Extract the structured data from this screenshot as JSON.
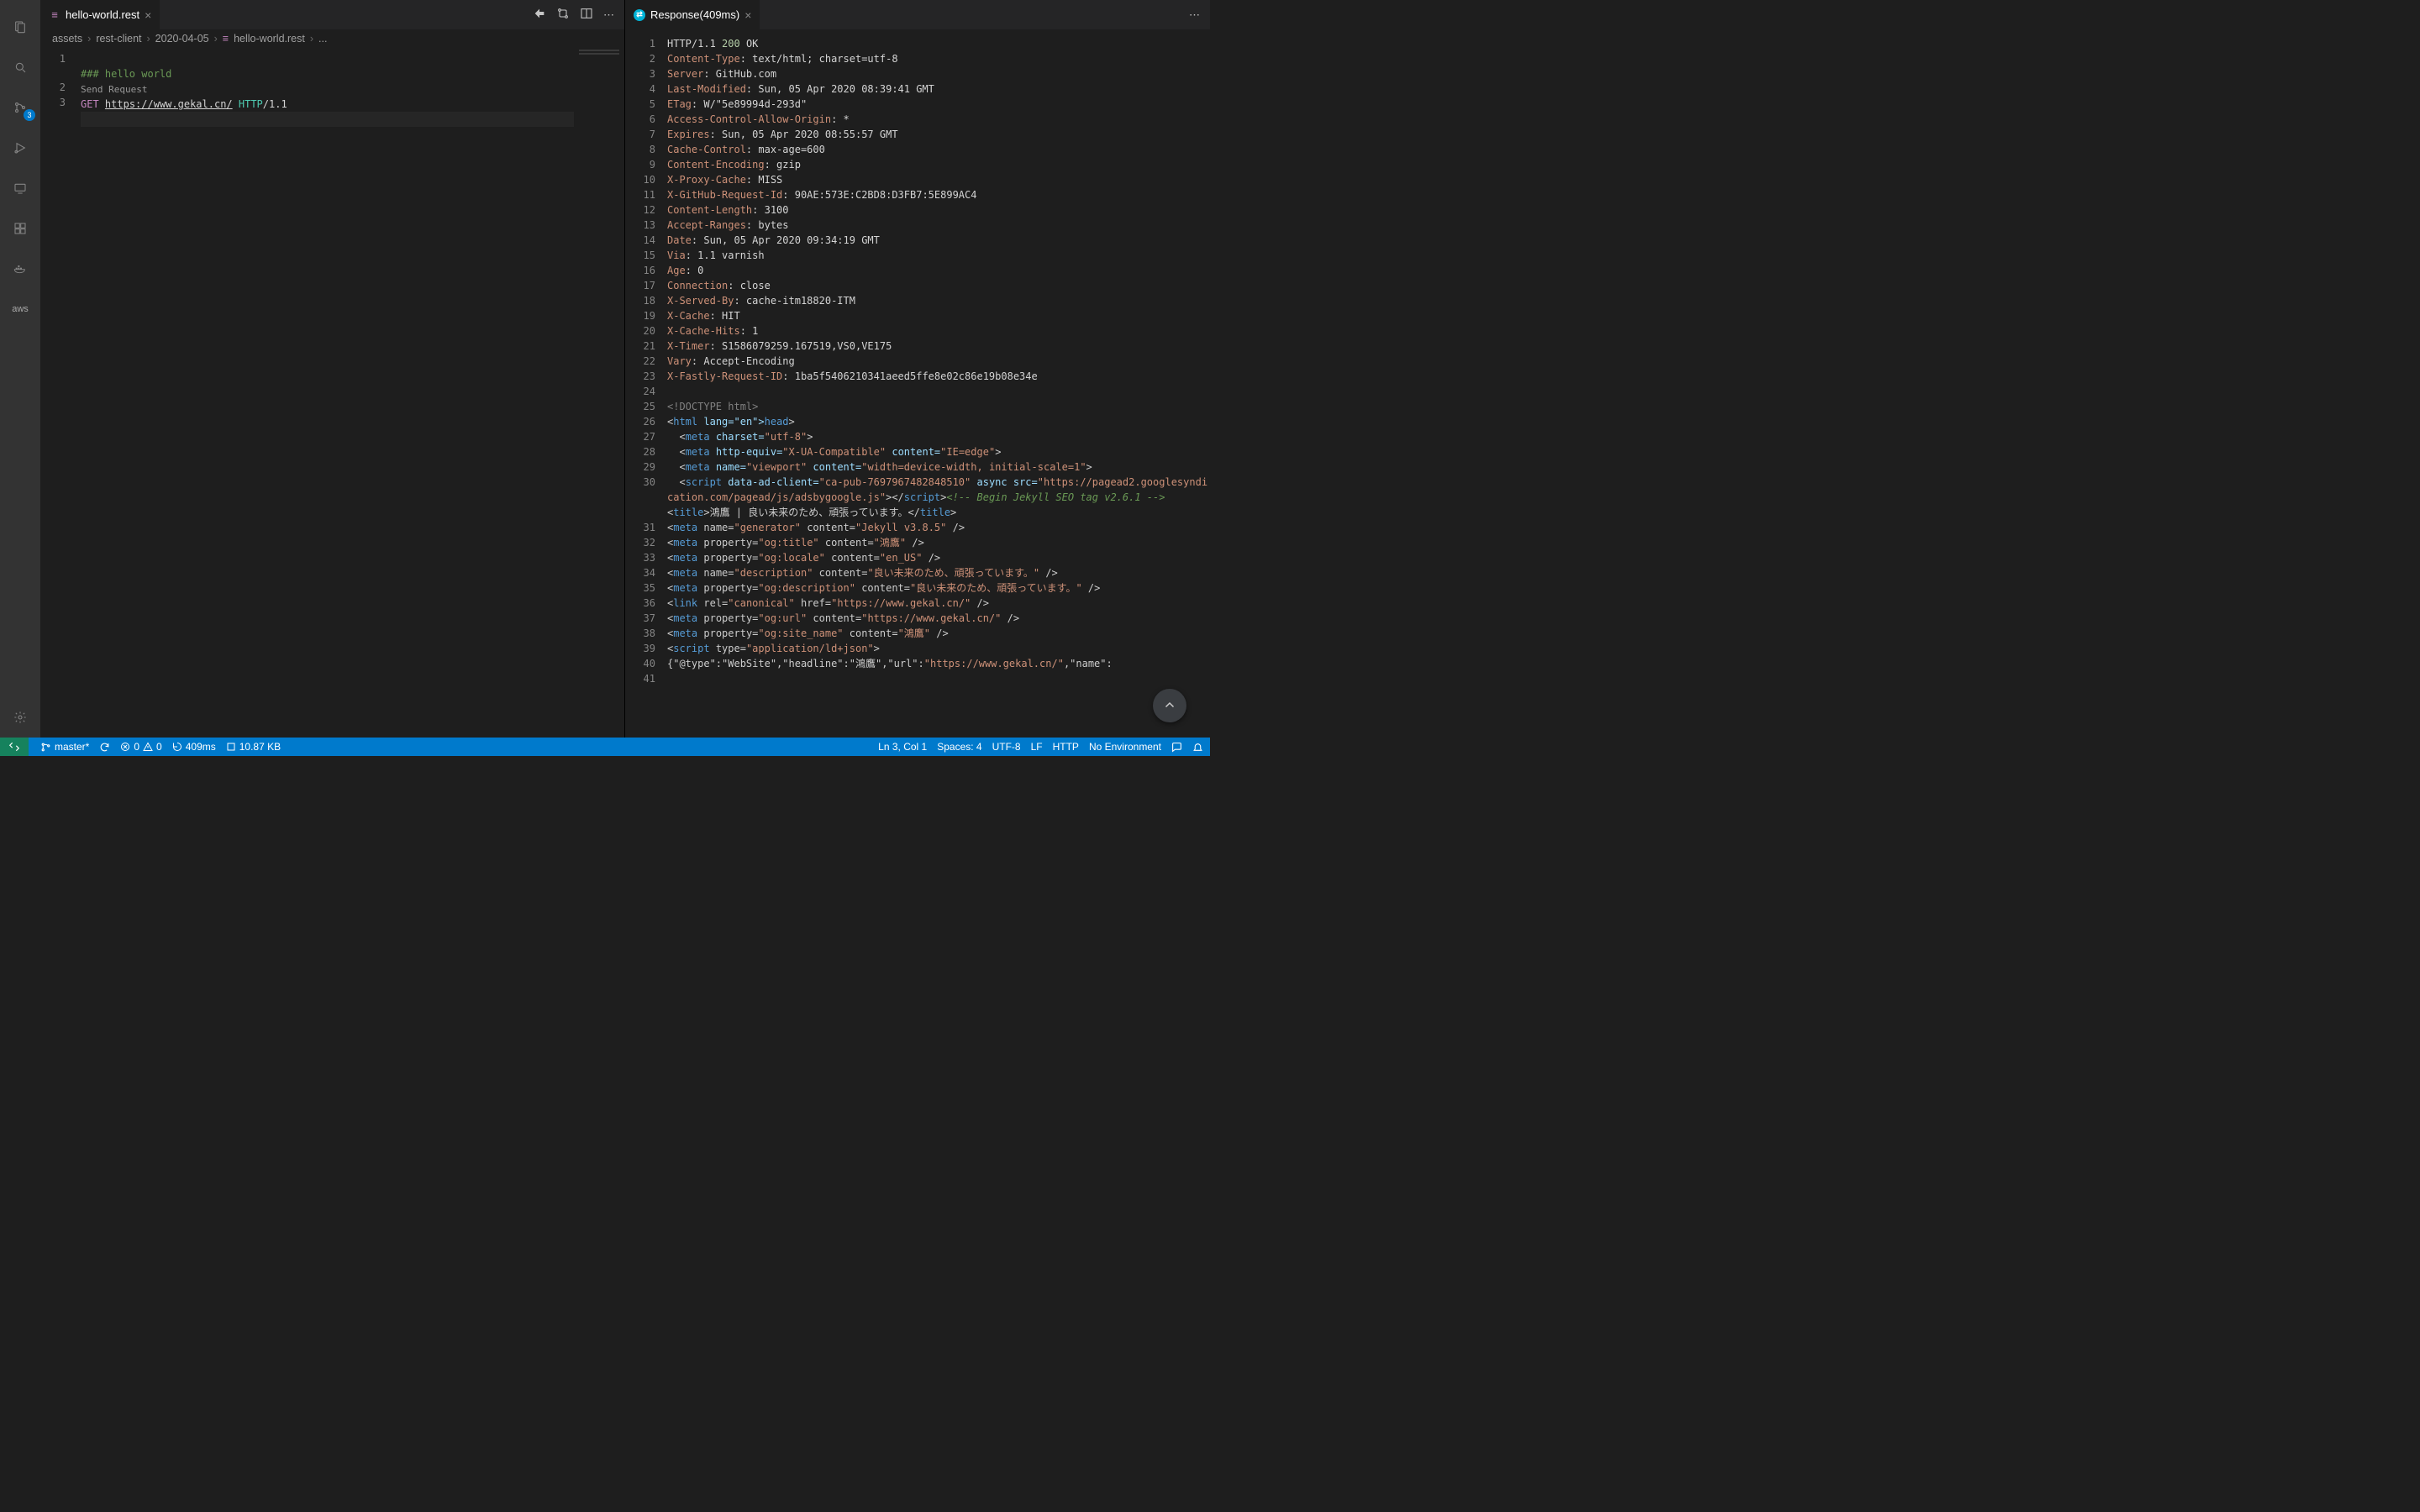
{
  "activityBadge": "3",
  "leftTab": {
    "name": "hello-world.rest"
  },
  "breadcrumbs": [
    "assets",
    "rest-client",
    "2020-04-05",
    "hello-world.rest",
    "..."
  ],
  "editor": {
    "lines": [
      "1",
      "2",
      "3"
    ],
    "commentLine": "### hello world",
    "codelens": "Send Request",
    "method": "GET",
    "url": "https://www.gekal.cn/",
    "proto": "HTTP",
    "protoVer": "/1.1"
  },
  "rightTab": {
    "name": "Response(409ms)"
  },
  "response": {
    "statusLine": {
      "proto": "HTTP/1.1",
      "code": "200",
      "text": "OK"
    },
    "headers": [
      {
        "k": "Content-Type",
        "v": ": text/html; charset=utf-8"
      },
      {
        "k": "Server",
        "v": ": GitHub.com"
      },
      {
        "k": "Last-Modified",
        "v": ": Sun, 05 Apr 2020 08:39:41 GMT"
      },
      {
        "k": "ETag",
        "v": ": W/\"5e89994d-293d\""
      },
      {
        "k": "Access-Control-Allow-Origin",
        "v": ": *"
      },
      {
        "k": "Expires",
        "v": ": Sun, 05 Apr 2020 08:55:57 GMT"
      },
      {
        "k": "Cache-Control",
        "v": ": max-age=600"
      },
      {
        "k": "Content-Encoding",
        "v": ": gzip"
      },
      {
        "k": "X-Proxy-Cache",
        "v": ": MISS"
      },
      {
        "k": "X-GitHub-Request-Id",
        "v": ": 90AE:573E:C2BD8:D3FB7:5E899AC4"
      },
      {
        "k": "Content-Length",
        "v": ": 3100"
      },
      {
        "k": "Accept-Ranges",
        "v": ": bytes"
      },
      {
        "k": "Date",
        "v": ": Sun, 05 Apr 2020 09:34:19 GMT"
      },
      {
        "k": "Via",
        "v": ": 1.1 varnish"
      },
      {
        "k": "Age",
        "v": ": 0"
      },
      {
        "k": "Connection",
        "v": ": close"
      },
      {
        "k": "X-Served-By",
        "v": ": cache-itm18820-ITM"
      },
      {
        "k": "X-Cache",
        "v": ": HIT"
      },
      {
        "k": "X-Cache-Hits",
        "v": ": 1"
      },
      {
        "k": "X-Timer",
        "v": ": S1586079259.167519,VS0,VE175"
      },
      {
        "k": "Vary",
        "v": ": Accept-Encoding"
      },
      {
        "k": "X-Fastly-Request-ID",
        "v": ": 1ba5f5406210341aeed5ffe8e02c86e19b08e34e"
      }
    ],
    "body": {
      "doctype": "<!DOCTYPE html>",
      "htmlOpen": {
        "pre": "<",
        "tag": "html",
        "rest": " lang=\"en\"><",
        "tag2": "head",
        "post": ">"
      },
      "metas": [
        {
          "indent": "  ",
          "pre": "<",
          "tag": "meta",
          "attrs": " charset=",
          "str": "\"utf-8\"",
          "post": ">"
        },
        {
          "indent": "  ",
          "pre": "<",
          "tag": "meta",
          "attrs": " http-equiv=",
          "str": "\"X-UA-Compatible\"",
          "attrs2": " content=",
          "str2": "\"IE=edge\"",
          "post": ">"
        },
        {
          "indent": "  ",
          "pre": "<",
          "tag": "meta",
          "attrs": " name=",
          "str": "\"viewport\"",
          "attrs2": " content=",
          "str2": "\"width=device-width, initial-scale=1\"",
          "post": ">"
        }
      ],
      "scriptLine": {
        "indent": "  ",
        "tag": "script",
        "attrs": " data-ad-client=",
        "str": "\"ca-pub-7697967482848510\"",
        "attrs2": " async src=",
        "str2": "\"https://pagead2.googlesyndication.com/pagead/js/adsbygoogle.js\"",
        "closeTag": "script",
        "commentTail": "<!-- Begin Jekyll SEO tag v2.6.1 -->"
      },
      "afterLines": [
        {
          "n": "31",
          "html": "<<t>title</t>>鴻鷹 | 良い未来のため、頑張っています。</<t>title</t>>"
        },
        {
          "n": "32",
          "html": "<<t>meta</t> name=<s>\"generator\"</s> content=<s>\"Jekyll v3.8.5\"</s> />"
        },
        {
          "n": "33",
          "html": "<<t>meta</t> property=<s>\"og:title\"</s> content=<s>\"鴻鷹\"</s> />"
        },
        {
          "n": "34",
          "html": "<<t>meta</t> property=<s>\"og:locale\"</s> content=<s>\"en_US\"</s> />"
        },
        {
          "n": "35",
          "html": "<<t>meta</t> name=<s>\"description\"</s> content=<s>\"良い未来のため、頑張っています。\"</s> />"
        },
        {
          "n": "36",
          "html": "<<t>meta</t> property=<s>\"og:description\"</s> content=<s>\"良い未来のため、頑張っています。\"</s> />"
        },
        {
          "n": "37",
          "html": "<<t>link</t> rel=<s>\"canonical\"</s> href=<s>\"https://www.gekal.cn/\"</s> />"
        },
        {
          "n": "38",
          "html": "<<t>meta</t> property=<s>\"og:url\"</s> content=<s>\"https://www.gekal.cn/\"</s> />"
        },
        {
          "n": "39",
          "html": "<<t>meta</t> property=<s>\"og:site_name\"</s> content=<s>\"鴻鷹\"</s> />"
        },
        {
          "n": "40",
          "html": "<<t>script</t> type=<s>\"application/ld+json\"</s>>"
        },
        {
          "n": "41",
          "html": "{\"@type\":\"WebSite\",\"headline\":\"鴻鷹\",\"url\":<s>\"https://www.gekal.cn/\"</s>,\"name\":"
        }
      ]
    }
  },
  "status": {
    "branch": "master*",
    "errors": "0",
    "warnings": "0",
    "duration": "409ms",
    "size": "10.87 KB",
    "pos": "Ln 3, Col 1",
    "spaces": "Spaces: 4",
    "enc": "UTF-8",
    "eol": "LF",
    "lang": "HTTP",
    "env": "No Environment"
  }
}
